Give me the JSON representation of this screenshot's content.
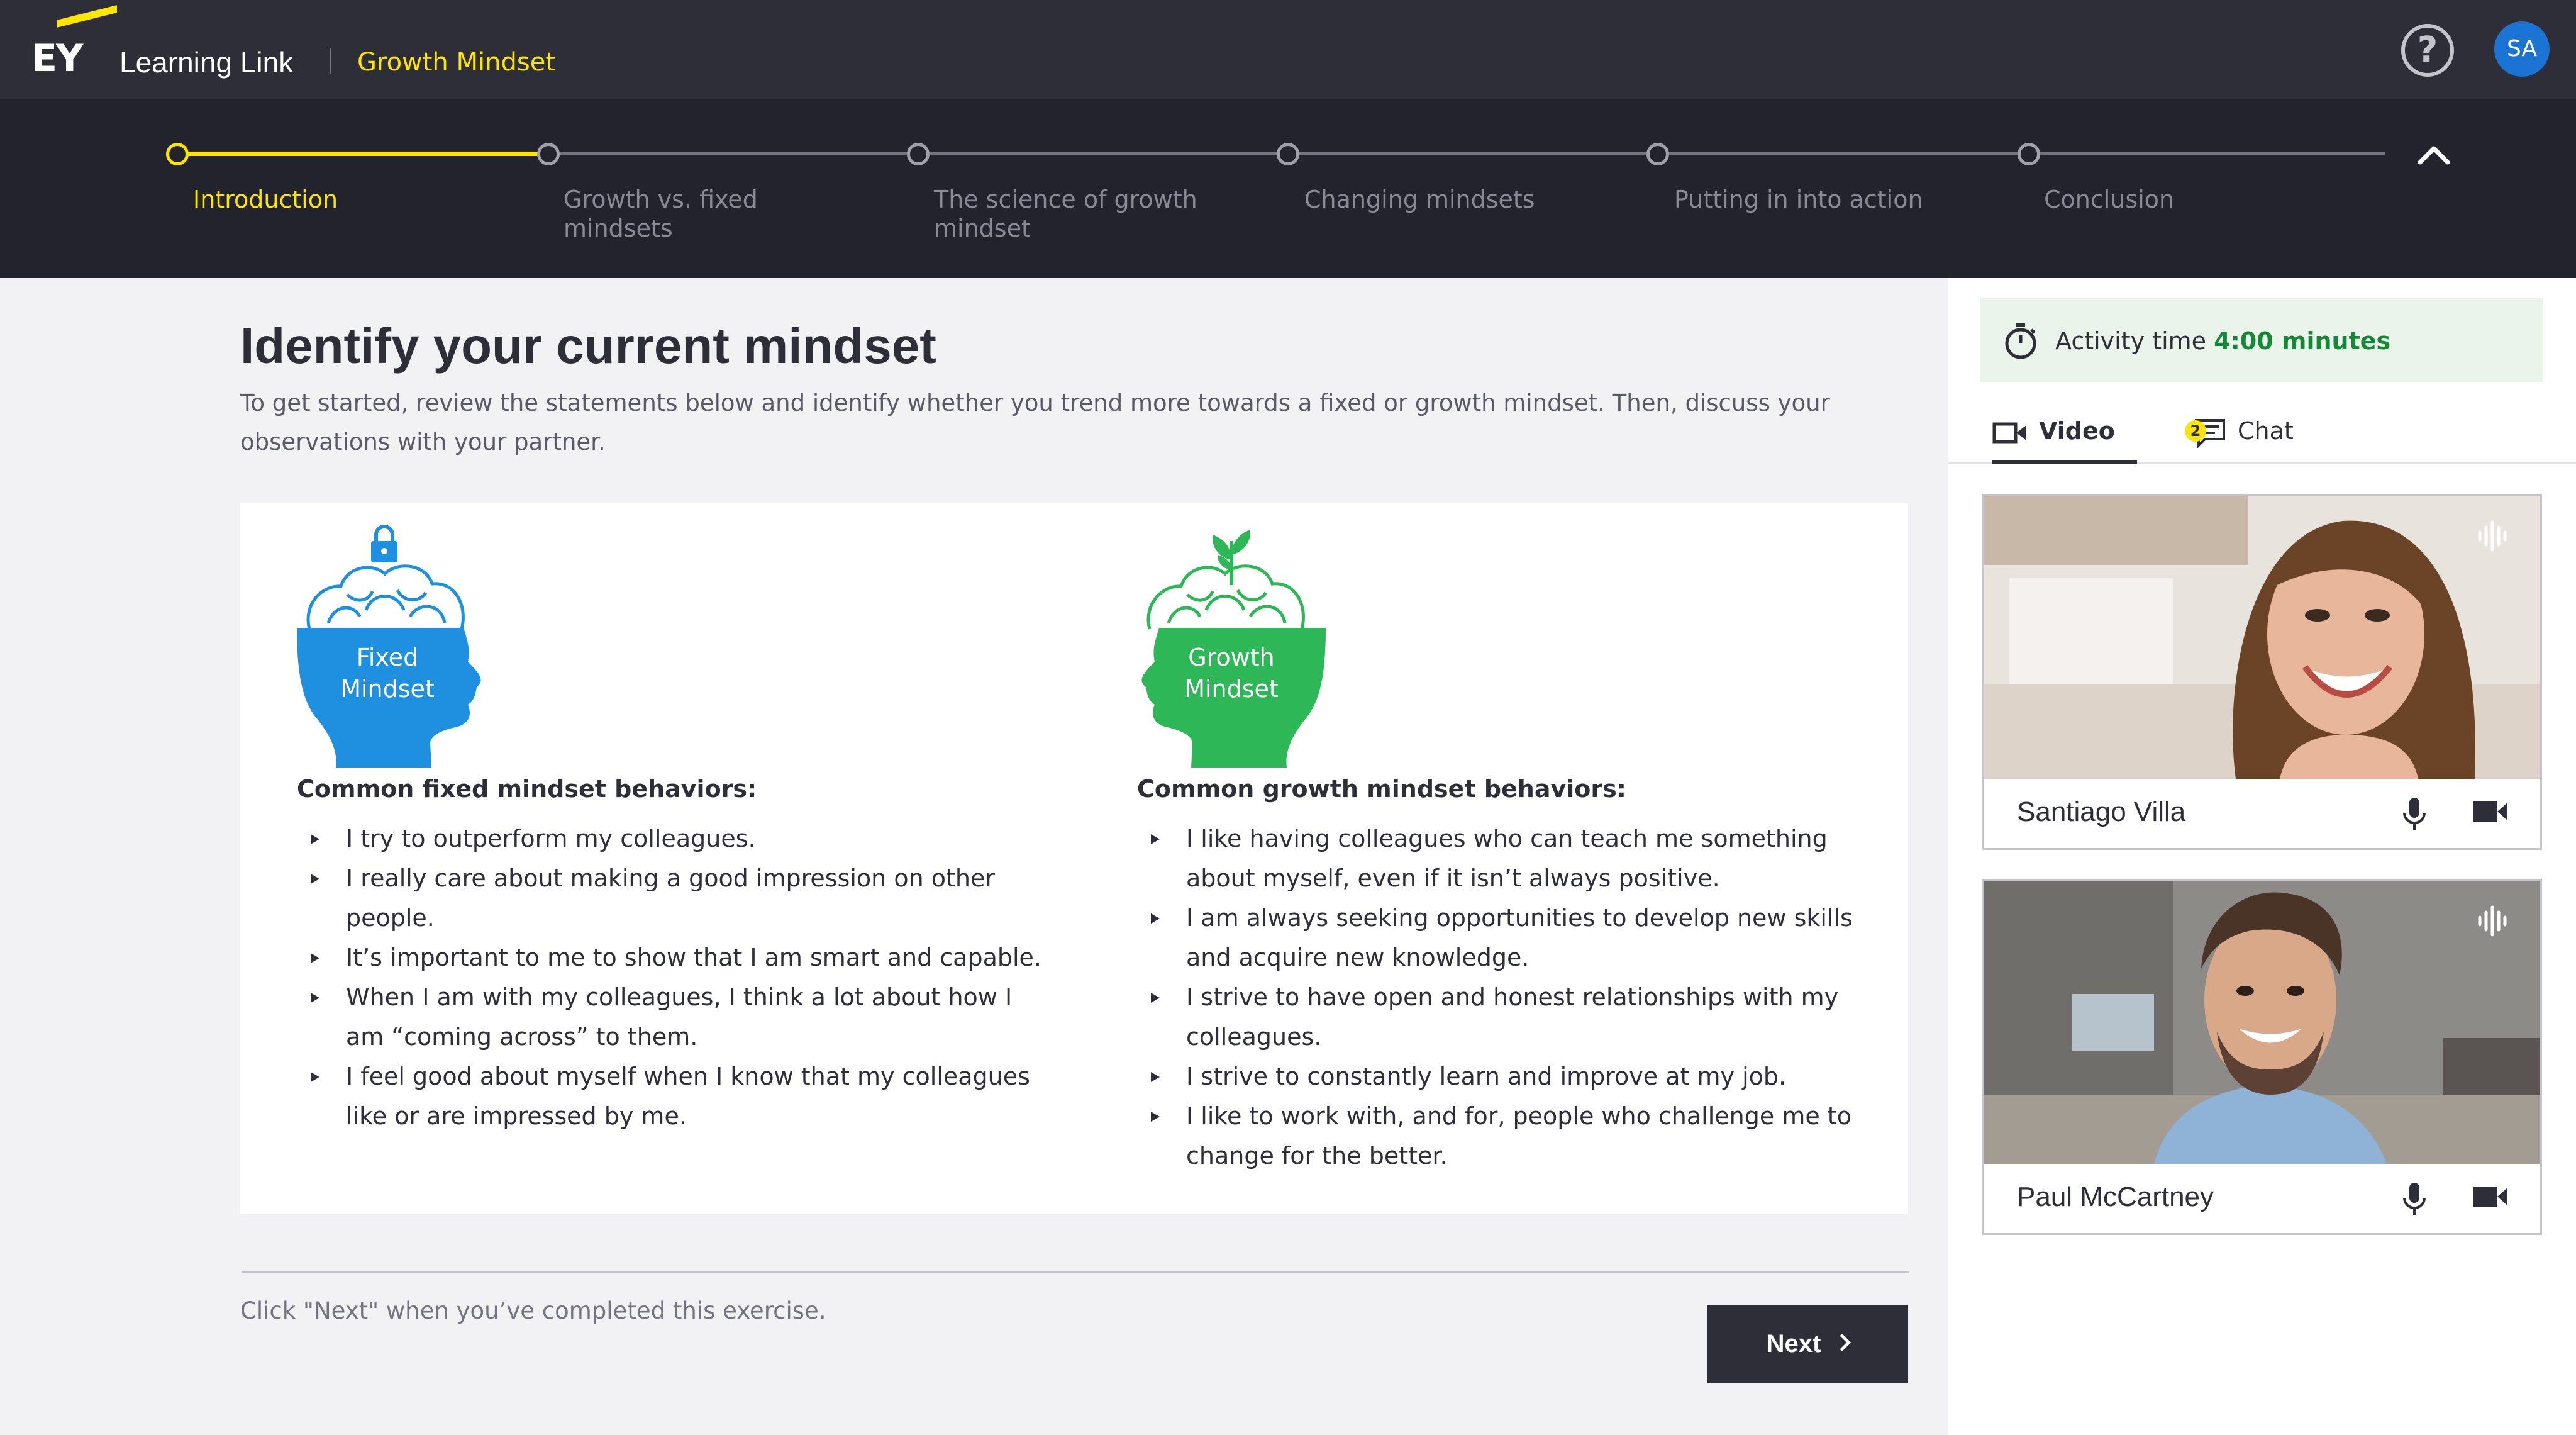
{
  "header": {
    "logo_text": "EY",
    "app_title": "Learning Link",
    "module_title": "Growth Mindset",
    "user_initials": "SA",
    "help_label": "?"
  },
  "stepper": {
    "steps": [
      {
        "label": "Introduction",
        "active": true
      },
      {
        "label": "Growth vs. fixed mindsets",
        "active": false
      },
      {
        "label": "The science of growth mindset",
        "active": false
      },
      {
        "label": "Changing mindsets",
        "active": false
      },
      {
        "label": "Putting in into action",
        "active": false
      },
      {
        "label": "Conclusion",
        "active": false
      }
    ]
  },
  "main": {
    "title": "Identify your current mindset",
    "intro": "To get started, review the statements below and identify whether you trend more towards a fixed or growth mindset. Then, discuss your observations with your partner.",
    "fixed": {
      "icon_label_line1": "Fixed",
      "icon_label_line2": "Mindset",
      "heading": "Common fixed mindset behaviors:",
      "items": [
        "I try to outperform my colleagues.",
        "I really care about making a good impression on other people.",
        "It’s important to me to show that I am smart and capable.",
        "When I am with my colleagues, I think a lot about how I am “coming across” to them.",
        "I feel good about myself when I know that my colleagues like or are impressed by me."
      ]
    },
    "growth": {
      "icon_label_line1": "Growth",
      "icon_label_line2": "Mindset",
      "heading": "Common growth mindset behaviors:",
      "items": [
        "I like having colleagues who can teach me something about myself, even if it isn’t always positive.",
        "I am always seeking opportunities to develop new skills and acquire new knowledge.",
        "I strive to have open and honest relationships with my colleagues.",
        "I strive to constantly learn and improve at my job.",
        "I like to work with, and for, people who challenge me to change for the better."
      ]
    },
    "footer_note": "Click \"Next\" when you’ve completed this exercise.",
    "next_label": "Next"
  },
  "sidebar": {
    "activity_label": "Activity time",
    "activity_value": "4:00 minutes",
    "tabs": {
      "video": "Video",
      "chat": "Chat",
      "chat_badge": "2"
    },
    "participants": [
      {
        "name": "Santiago Villa"
      },
      {
        "name": "Paul McCartney"
      }
    ]
  },
  "colors": {
    "brand_yellow": "#ffe600",
    "dark": "#2e2e38",
    "fixed_blue": "#1f8fe0",
    "growth_green": "#2db757",
    "activity_green": "#168736"
  }
}
